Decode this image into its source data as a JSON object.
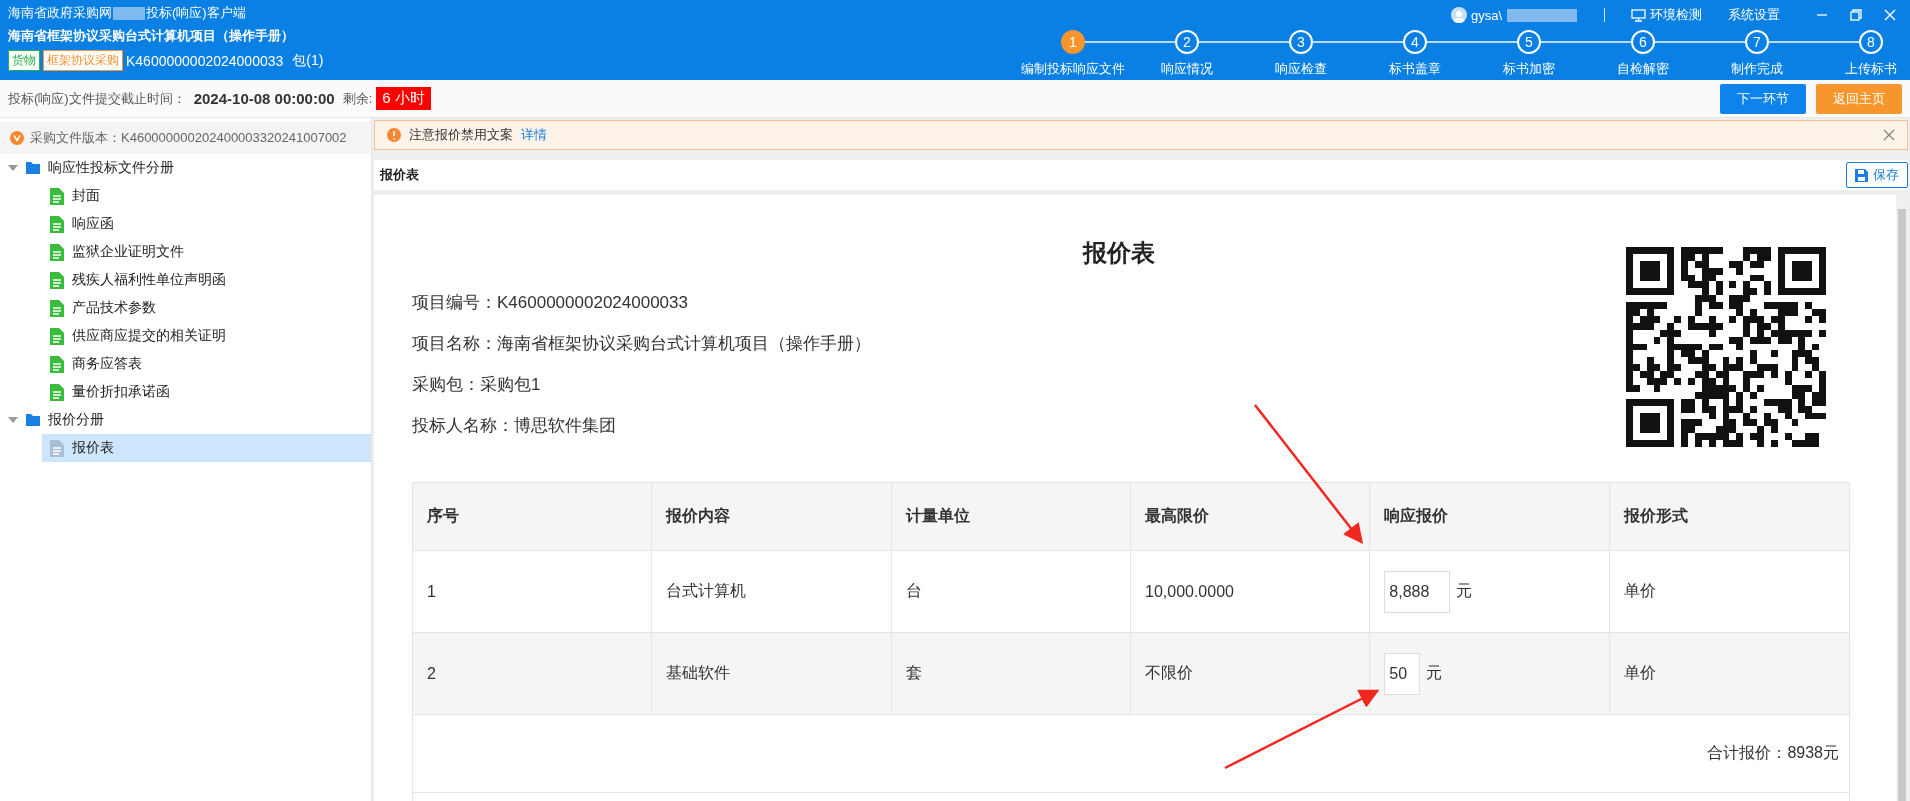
{
  "window": {
    "title_prefix": "海南省政府采购网",
    "title_suffix": "投标(响应)客户端",
    "user": "gysa\\",
    "links": [
      "环境检测",
      "系统设置"
    ]
  },
  "project": {
    "name": "海南省框架协议采购台式计算机项目（操作手册）",
    "tags": [
      {
        "label": "货物",
        "color": "#27b24a"
      },
      {
        "label": "框架协议采购",
        "color": "#f5922f"
      }
    ],
    "code": "K4600000002024000033",
    "package": "包(1)"
  },
  "steps": [
    {
      "number": "1",
      "label": "编制投标响应文件",
      "selected": true
    },
    {
      "number": "2",
      "label": "响应情况",
      "selected": false
    },
    {
      "number": "3",
      "label": "响应检查",
      "selected": false
    },
    {
      "number": "4",
      "label": "标书盖章",
      "selected": false
    },
    {
      "number": "5",
      "label": "标书加密",
      "selected": false
    },
    {
      "number": "6",
      "label": "自检解密",
      "selected": false
    },
    {
      "number": "7",
      "label": "制作完成",
      "selected": false
    },
    {
      "number": "8",
      "label": "上传标书",
      "selected": false
    }
  ],
  "deadline": {
    "label": "投标(响应)文件提交截止时间：",
    "value": "2024-10-08 00:00:00",
    "remaining_label": "剩余:",
    "remaining": "6 小时"
  },
  "buttons": [
    {
      "label": "下一环节",
      "kind": "primary"
    },
    {
      "label": "返回主页",
      "kind": "warning"
    }
  ],
  "sidebar": {
    "version": "采购文件版本：K460000000202400003320241007002",
    "tree": [
      {
        "label": "响应性投标文件分册",
        "expanded": true,
        "children": [
          {
            "label": "封面",
            "selected": false
          },
          {
            "label": "响应函",
            "selected": false
          },
          {
            "label": "监狱企业证明文件",
            "selected": false
          },
          {
            "label": "残疾人福利性单位声明函",
            "selected": false
          },
          {
            "label": "产品技术参数",
            "selected": false
          },
          {
            "label": "供应商应提交的相关证明",
            "selected": false
          },
          {
            "label": "商务应答表",
            "selected": false
          },
          {
            "label": "量价折扣承诺函",
            "selected": false
          }
        ]
      },
      {
        "label": "报价分册",
        "expanded": true,
        "children": [
          {
            "label": "报价表",
            "selected": true
          }
        ]
      }
    ]
  },
  "notice": {
    "text": "注意报价禁用文案",
    "link": "详情"
  },
  "panel": {
    "title": "报价表",
    "save": "保存"
  },
  "document": {
    "title": "报价表",
    "fields": [
      "项目编号：K4600000002024000033",
      "项目名称：海南省框架协议采购台式计算机项目（操作手册）",
      "采购包：采购包1",
      "投标人名称：博思软件集团"
    ],
    "table": {
      "columns": [
        "序号",
        "报价内容",
        "计量单位",
        "最高限价",
        "响应报价",
        "报价形式"
      ],
      "rows": [
        {
          "index": "1",
          "content": "台式计算机",
          "unit": "台",
          "max_price": "10,000.0000",
          "price": "8,888",
          "currency": "元",
          "form": "单价"
        },
        {
          "index": "2",
          "content": "基础软件",
          "unit": "套",
          "max_price": "不限价",
          "price": "50",
          "currency": "元",
          "form": "单价"
        }
      ]
    },
    "total": "合计报价：8938元"
  }
}
